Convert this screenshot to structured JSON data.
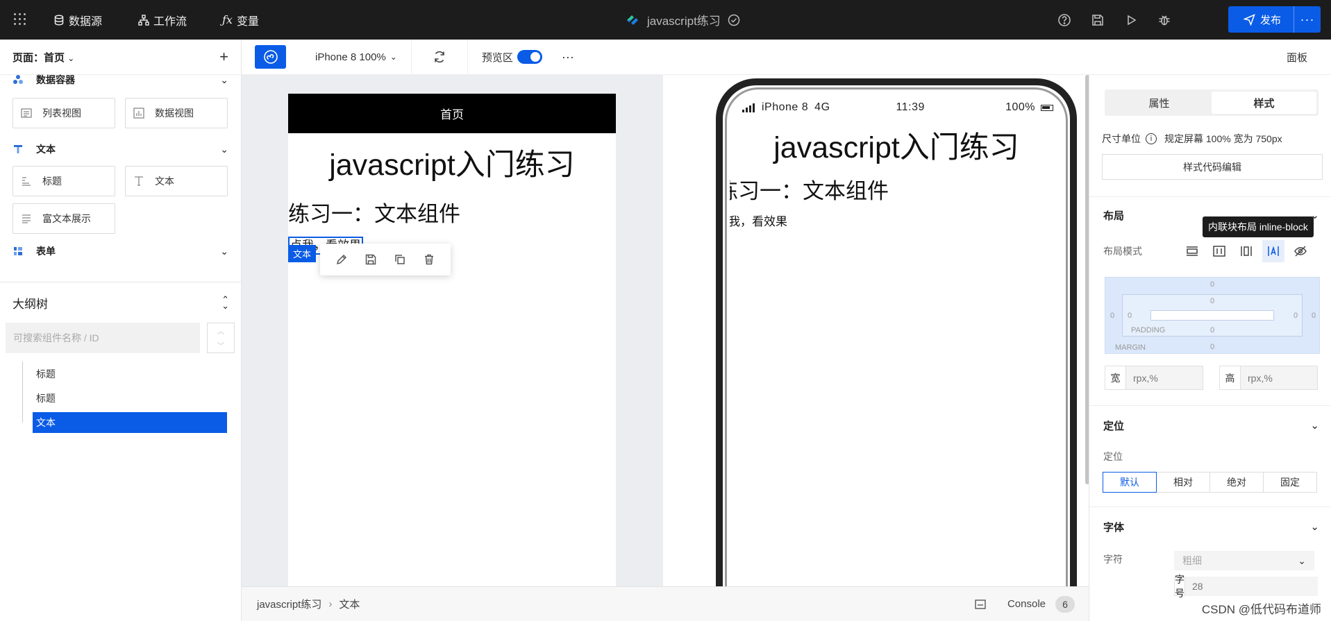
{
  "topbar": {
    "nav": [
      {
        "label": "数据源",
        "icon": "database-icon"
      },
      {
        "label": "工作流",
        "icon": "workflow-icon"
      },
      {
        "label": "变量",
        "icon": "function-icon"
      }
    ],
    "project_title": "javascript练习",
    "publish_label": "发布",
    "more_label": "···"
  },
  "left": {
    "page_label": "页面：首页",
    "add_label": "+",
    "categories": [
      {
        "label": "数据容器",
        "items": [
          "列表视图",
          "数据视图"
        ]
      },
      {
        "label": "文本",
        "items": [
          "标题",
          "文本",
          "富文本展示"
        ]
      },
      {
        "label": "表单",
        "items": []
      }
    ],
    "outline_title": "大纲树",
    "search_placeholder": "可搜索组件名称 / ID",
    "tree": [
      "标题",
      "标题",
      "文本"
    ]
  },
  "toolbar": {
    "device": "iPhone 8 100%",
    "preview_label": "预览区",
    "more": "···",
    "panel_label": "面板"
  },
  "canvas": {
    "page_header": "首页",
    "heading_big": "javascript入门练习",
    "heading_mid": "练习一：文本组件",
    "text_small": "点我，看效果",
    "selection_badge": "文本"
  },
  "phone": {
    "carrier": "iPhone 8",
    "network": "4G",
    "time": "11:39",
    "battery": "100%",
    "heading_big": "javascript入门练习",
    "heading_mid": "练习一：文本组件",
    "text_small": "点我，看效果"
  },
  "bottombar": {
    "crumbs": [
      "javascript练习",
      "文本"
    ],
    "console_label": "Console",
    "console_count": "6"
  },
  "right": {
    "tabs": [
      "属性",
      "样式"
    ],
    "active_tab": "样式",
    "unit_label": "尺寸单位",
    "unit_value": "规定屏幕 100% 宽为 750px",
    "code_button": "样式代码编辑",
    "layout_title": "布局",
    "layout_mode_label": "布局模式",
    "tooltip": "内联块布局 inline-block",
    "box_labels": {
      "padding": "PADDING",
      "margin": "MARGIN",
      "zero": "0"
    },
    "width_label": "宽",
    "height_label": "高",
    "size_placeholder": "rpx,%",
    "position_title": "定位",
    "position_label": "定位",
    "position_options": [
      "默认",
      "相对",
      "绝对",
      "固定"
    ],
    "font_title": "字体",
    "font_weight_label": "字符",
    "font_weight_placeholder": "粗细",
    "font_size_label": "字号",
    "font_size_value": "28"
  },
  "watermark": "CSDN @低代码布道师",
  "colors": {
    "accent": "#0a5ce6",
    "topbar": "#1c1c1c"
  }
}
